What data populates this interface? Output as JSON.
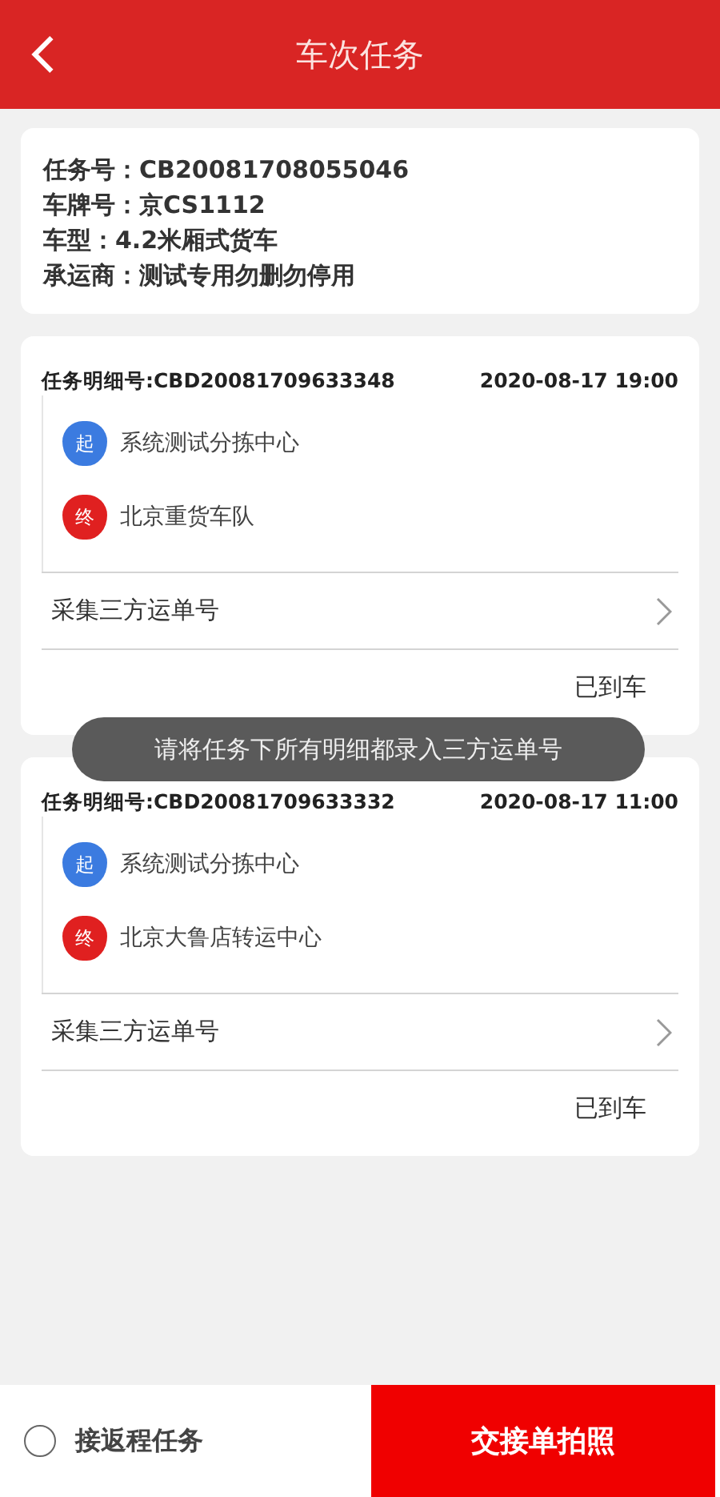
{
  "header": {
    "title": "车次任务"
  },
  "info": [
    "任务号：CB20081708055046",
    "车牌号：京CS1112",
    "车型：4.2米厢式货车",
    "承运商：测试专用勿删勿停用"
  ],
  "details": [
    {
      "number": "任务明细号:CBD20081709633348",
      "time": "2020-08-17 19:00",
      "stops": [
        {
          "kind": "start",
          "badge": "起",
          "name": "系统测试分拣中心"
        },
        {
          "kind": "end",
          "badge": "终",
          "name": "北京重货车队"
        }
      ],
      "collect": "采集三方运单号",
      "status": "已到车"
    },
    {
      "number": "任务明细号:CBD20081709633332",
      "time": "2020-08-17 11:00",
      "stops": [
        {
          "kind": "start",
          "badge": "起",
          "name": "系统测试分拣中心"
        },
        {
          "kind": "end",
          "badge": "终",
          "name": "北京大鲁店转运中心"
        }
      ],
      "collect": "采集三方运单号",
      "status": "已到车"
    }
  ],
  "toast": "请将任务下所有明细都录入三方运单号",
  "footer": {
    "return_task": {
      "label": "接返程任务",
      "checked": false
    },
    "button": "交接单拍照"
  }
}
